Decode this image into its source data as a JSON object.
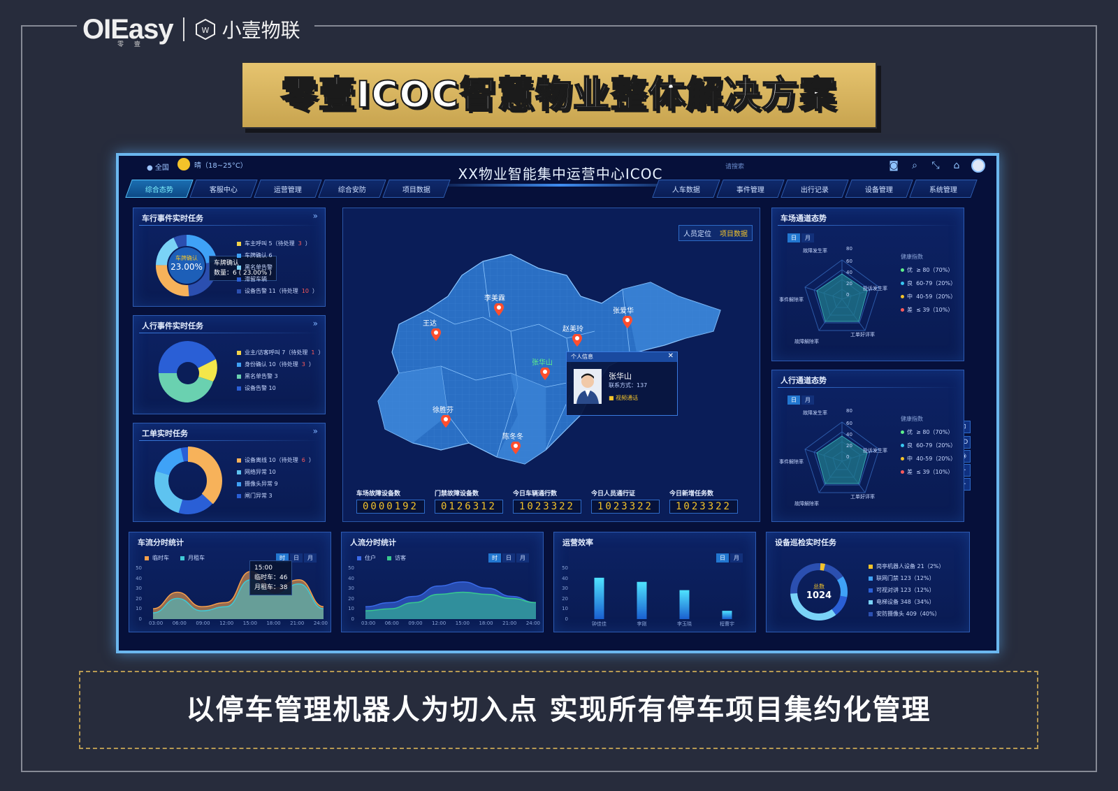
{
  "logo": {
    "brand": "OIEasy",
    "brand_sub": "零 壹",
    "name": "小壹物联"
  },
  "title": "零壹ICOC智慧物业整体解决方案",
  "caption": "以停车管理机器人为切入点  实现所有停车项目集约化管理",
  "screen": {
    "location": "全国",
    "weather": "晴（18~25°C）",
    "search_placeholder": "请搜索",
    "main_title": "XX物业智能集中运营中心ICOC",
    "tabs_left": [
      "综合态势",
      "客服中心",
      "运营管理",
      "综合安防",
      "项目数据"
    ],
    "tabs_right": [
      "人车数据",
      "事件管理",
      "出行记录",
      "设备管理",
      "系统管理"
    ]
  },
  "panel_vehicle": {
    "title": "车行事件实时任务",
    "center_label": "车牌确认",
    "center_value": "23.00%",
    "tooltip_title": "车牌确认",
    "tooltip_value": "数量：6 ( 23.00% )",
    "legend": [
      {
        "text": "车主呼叫 5（待处理",
        "count": "3",
        "suffix": "）",
        "color": "#f3d34a"
      },
      {
        "text": "车牌确认 6",
        "count": "",
        "suffix": "",
        "color": "#3fa2f7"
      },
      {
        "text": "黑名单告警",
        "count": "",
        "suffix": "",
        "color": "#7ad3f7"
      },
      {
        "text": "滞留车辆",
        "count": "",
        "suffix": "",
        "color": "#2a5fd6"
      },
      {
        "text": "设备告警 11（待处理",
        "count": "10",
        "suffix": "）",
        "color": "#2b4fb0"
      }
    ]
  },
  "panel_person": {
    "title": "人行事件实时任务",
    "legend": [
      {
        "text": "业主/访客呼叫 7（待处理",
        "count": "1",
        "suffix": "）",
        "color": "#f3d34a"
      },
      {
        "text": "身份确认 10（待处理",
        "count": "3",
        "suffix": "）",
        "color": "#3fa2f7"
      },
      {
        "text": "黑名单告警 3",
        "count": "",
        "suffix": "",
        "color": "#6ad1b0"
      },
      {
        "text": "设备告警 10",
        "count": "",
        "suffix": "",
        "color": "#2a5fd6"
      }
    ]
  },
  "panel_work": {
    "title": "工单实时任务",
    "legend": [
      {
        "text": "设备离线 10（待处理",
        "count": "6",
        "suffix": "）",
        "color": "#f7b25a"
      },
      {
        "text": "网络异常 10",
        "count": "",
        "suffix": "",
        "color": "#5ec3f0"
      },
      {
        "text": "摄像头异常 9",
        "count": "",
        "suffix": "",
        "color": "#3fa2f7"
      },
      {
        "text": "闸门异常 3",
        "count": "",
        "suffix": "",
        "color": "#2a5fd6"
      }
    ]
  },
  "map": {
    "tabs": [
      "人员定位",
      "项目数据"
    ],
    "people": [
      "李美霖",
      "王达",
      "赵美玲",
      "张爱华",
      "张华山",
      "徐胜芬",
      "陈冬冬"
    ],
    "info": {
      "header": "个人信息",
      "name": "张华山",
      "phone": "联系方式：137",
      "video": "视频通话"
    },
    "controls": [
      "2D",
      "+",
      "−"
    ],
    "counters": [
      {
        "label": "车场故障设备数",
        "value": "0000192"
      },
      {
        "label": "门禁故障设备数",
        "value": "0126312"
      },
      {
        "label": "今日车辆通行数",
        "value": "1023322"
      },
      {
        "label": "今日人员通行证",
        "value": "1023322"
      },
      {
        "label": "今日新增任务数",
        "value": "1023322"
      }
    ]
  },
  "radar_vehicle": {
    "title": "车场通道态势",
    "tabs": [
      "日",
      "月"
    ],
    "axes": [
      "故障发生率",
      "投诉发生率",
      "工单好评率",
      "故障解除率",
      "事件解除率"
    ],
    "ticks": [
      "80",
      "60",
      "40",
      "20",
      "0"
    ],
    "legend_title": "健康指数",
    "legend": [
      {
        "label": "优",
        "range": "≥ 80（70%）",
        "color": "#5ef08a"
      },
      {
        "label": "良",
        "range": "60-79（20%）",
        "color": "#39c6f0"
      },
      {
        "label": "中",
        "range": "40-59（20%）",
        "color": "#f3c32a"
      },
      {
        "label": "差",
        "range": "≤ 39（10%）",
        "color": "#ff5b5b"
      }
    ]
  },
  "radar_person": {
    "title": "人行通道态势",
    "tabs": [
      "日",
      "月"
    ],
    "axes": [
      "故障发生率",
      "投诉发生率",
      "工单好评率",
      "故障解除率",
      "事件解除率"
    ],
    "ticks": [
      "80",
      "60",
      "40",
      "20",
      "0"
    ],
    "legend_title": "健康指数",
    "legend": [
      {
        "label": "优",
        "range": "≥ 80（70%）",
        "color": "#5ef08a"
      },
      {
        "label": "良",
        "range": "60-79（20%）",
        "color": "#39c6f0"
      },
      {
        "label": "中",
        "range": "40-59（20%）",
        "color": "#f3c32a"
      },
      {
        "label": "差",
        "range": "≤ 39（10%）",
        "color": "#ff5b5b"
      }
    ]
  },
  "traffic": {
    "title": "车流分时统计",
    "legend": [
      "临时车",
      "月租车"
    ],
    "tabs": [
      "时",
      "日",
      "月"
    ],
    "y_ticks": [
      "50",
      "40",
      "30",
      "20",
      "10",
      "0"
    ],
    "x_ticks": [
      "03:00",
      "06:00",
      "09:00",
      "12:00",
      "15:00",
      "18:00",
      "21:00",
      "24:00"
    ],
    "tooltip": {
      "time": "15:00",
      "line1": "临时车：46",
      "line2": "月租车：38"
    }
  },
  "people_flow": {
    "title": "人流分时统计",
    "legend": [
      "住户",
      "访客"
    ],
    "tabs": [
      "时",
      "日",
      "月"
    ],
    "y_ticks": [
      "50",
      "40",
      "30",
      "20",
      "10",
      "0"
    ],
    "x_ticks": [
      "03:00",
      "06:00",
      "09:00",
      "12:00",
      "15:00",
      "18:00",
      "21:00",
      "24:00"
    ]
  },
  "efficiency": {
    "title": "运营效率",
    "tabs": [
      "日",
      "月"
    ],
    "y_ticks": [
      "50",
      "40",
      "30",
      "20",
      "10",
      "0"
    ]
  },
  "patrol": {
    "title": "设备巡检实时任务",
    "center_label": "总数",
    "center_value": "1024",
    "legend": [
      {
        "text": "岗亭机器人设备 21（2%）",
        "color": "#f3c32a"
      },
      {
        "text": "联网门禁 123（12%）",
        "color": "#3fa2f7"
      },
      {
        "text": "可视对讲 123（12%）",
        "color": "#2a5fd6"
      },
      {
        "text": "电梯设备 348（34%）",
        "color": "#7ad3f7"
      },
      {
        "text": "安防摄像头 409（40%）",
        "color": "#2b4fb0"
      }
    ]
  },
  "chart_data": [
    {
      "type": "area",
      "title": "车流分时统计",
      "x": [
        "03:00",
        "06:00",
        "09:00",
        "12:00",
        "15:00",
        "18:00",
        "21:00",
        "24:00"
      ],
      "ylim": [
        0,
        50
      ],
      "series": [
        {
          "name": "临时车",
          "values": [
            10,
            26,
            12,
            16,
            46,
            30,
            38,
            12
          ],
          "color": "#f7a04a"
        },
        {
          "name": "月租车",
          "values": [
            6,
            20,
            8,
            12,
            38,
            24,
            34,
            10
          ],
          "color": "#3fc9d6"
        }
      ]
    },
    {
      "type": "area",
      "title": "人流分时统计",
      "x": [
        "03:00",
        "06:00",
        "09:00",
        "12:00",
        "15:00",
        "18:00",
        "21:00",
        "24:00"
      ],
      "ylim": [
        0,
        50
      ],
      "series": [
        {
          "name": "住户",
          "values": [
            12,
            16,
            22,
            32,
            36,
            30,
            22,
            16
          ],
          "color": "#3a6ae8"
        },
        {
          "name": "访客",
          "values": [
            8,
            10,
            16,
            24,
            26,
            24,
            20,
            16
          ],
          "color": "#38c98e"
        }
      ]
    },
    {
      "type": "bar",
      "title": "运营效率",
      "categories": [
        "钟佳佳",
        "李刚",
        "李玉晓",
        "程曹宇"
      ],
      "values": [
        40,
        36,
        28,
        8
      ],
      "ylim": [
        0,
        50
      ]
    }
  ]
}
